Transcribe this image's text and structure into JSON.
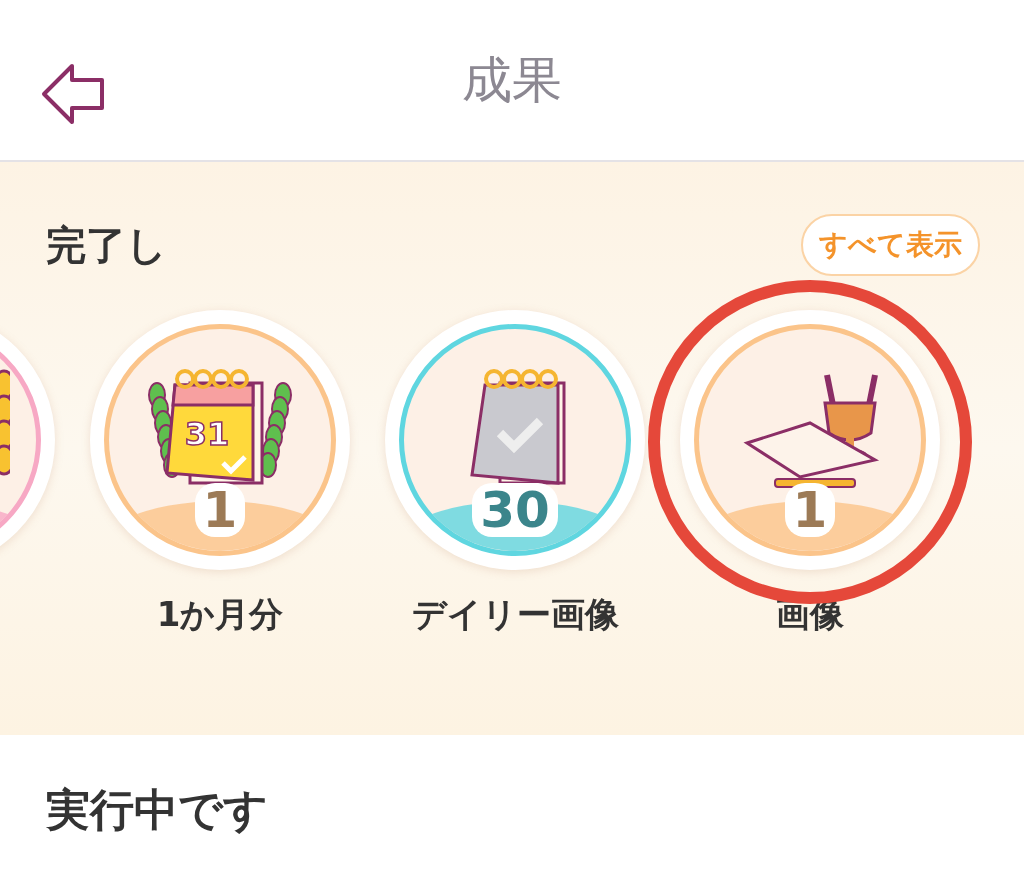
{
  "header": {
    "title": "成果"
  },
  "completed": {
    "heading": "完了し",
    "show_all": "すべて表示",
    "badges": [
      {
        "kind": "wheat",
        "color": "#f7a8c4",
        "highlighted": false
      },
      {
        "kind": "laurel-calendar",
        "icon_text": "31",
        "count": "1",
        "label": "1か月分",
        "color": "#fbc48a",
        "highlighted": false
      },
      {
        "kind": "calendar",
        "count": "30",
        "label": "デイリー画像",
        "color": "#5fd6e0",
        "highlighted": false
      },
      {
        "kind": "trophy",
        "count": "1",
        "label": "画像",
        "color": "#fbc48a",
        "highlighted": true
      }
    ]
  },
  "in_progress": {
    "heading": "実行中です"
  }
}
